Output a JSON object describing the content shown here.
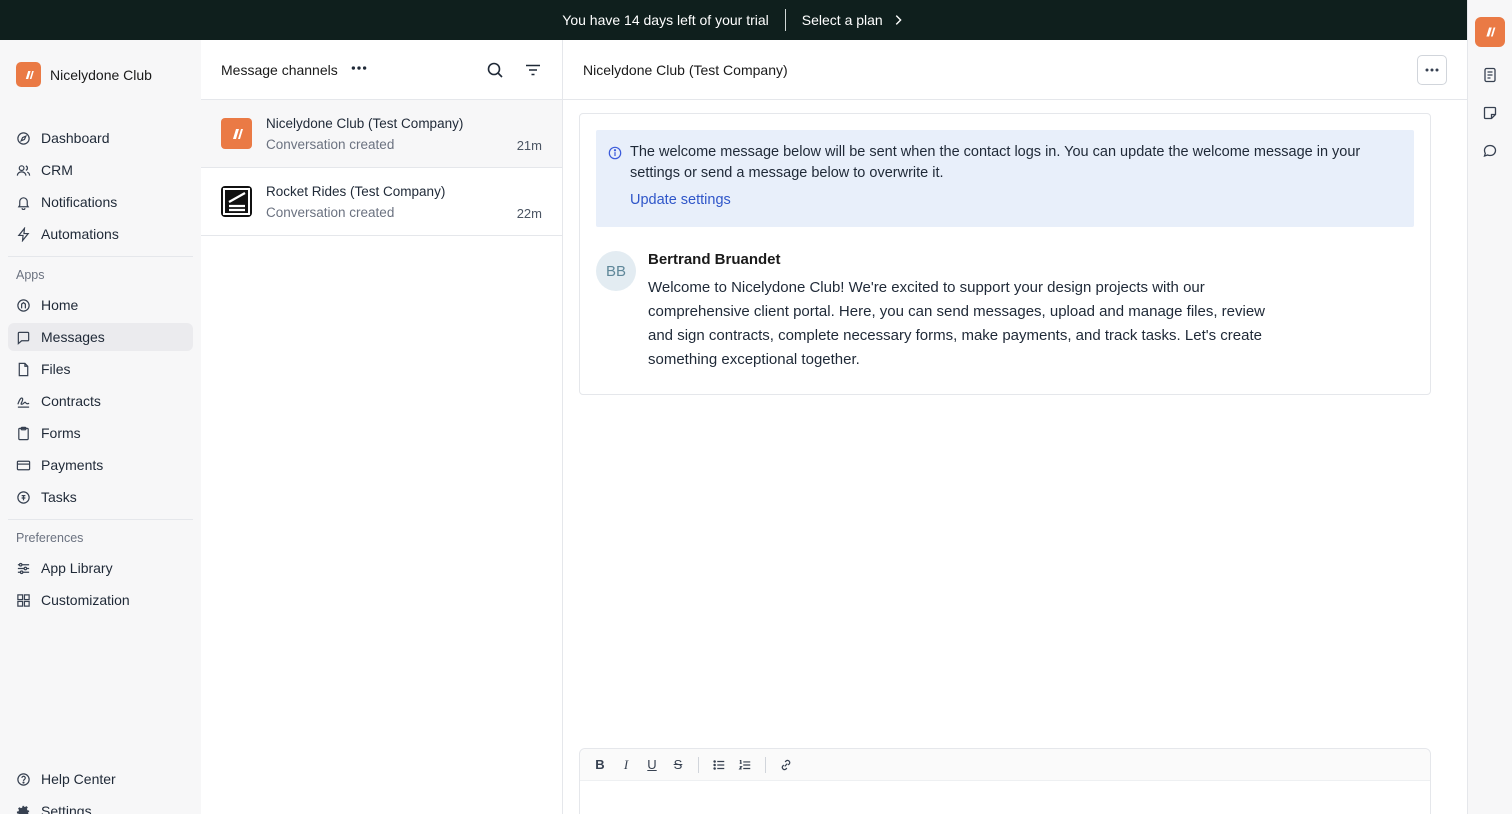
{
  "trial": {
    "message": "You have 14 days left of your trial",
    "cta": "Select a plan"
  },
  "sidebar": {
    "brand": "Nicelydone Club",
    "main_items": [
      {
        "label": "Dashboard"
      },
      {
        "label": "CRM"
      },
      {
        "label": "Notifications"
      },
      {
        "label": "Automations"
      }
    ],
    "apps_label": "Apps",
    "apps": [
      {
        "label": "Home"
      },
      {
        "label": "Messages"
      },
      {
        "label": "Files"
      },
      {
        "label": "Contracts"
      },
      {
        "label": "Forms"
      },
      {
        "label": "Payments"
      },
      {
        "label": "Tasks"
      }
    ],
    "prefs_label": "Preferences",
    "prefs": [
      {
        "label": "App Library"
      },
      {
        "label": "Customization"
      }
    ],
    "footer": [
      {
        "label": "Help Center"
      },
      {
        "label": "Settings"
      }
    ]
  },
  "channels": {
    "title": "Message channels",
    "items": [
      {
        "name": "Nicelydone Club (Test Company)",
        "status": "Conversation created",
        "time": "21m"
      },
      {
        "name": "Rocket Rides (Test Company)",
        "status": "Conversation created",
        "time": "22m"
      }
    ]
  },
  "conversation": {
    "title": "Nicelydone Club (Test Company)",
    "notice": "The welcome message below will be sent when the contact logs in. You can update the welcome message in your settings or send a message below to overwrite it.",
    "notice_link": "Update settings",
    "message": {
      "initials": "BB",
      "author": "Bertrand Bruandet",
      "body": "Welcome to Nicelydone Club! We're excited to support your design projects with our comprehensive client portal. Here, you can send messages, upload and manage files, review and sign contracts, complete necessary forms, make payments, and track tasks. Let's create something exceptional together."
    }
  },
  "composer": {
    "tools": [
      "B",
      "I",
      "U",
      "S"
    ]
  },
  "colors": {
    "brand": "#ea7a45",
    "topbar": "#0f1f1d",
    "link": "#2f56c9",
    "notice_bg": "#e8effa"
  }
}
